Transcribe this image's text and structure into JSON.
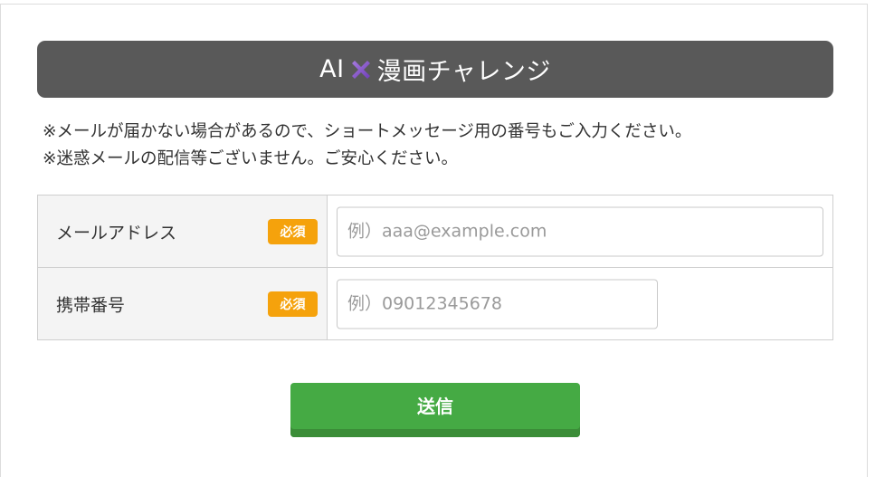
{
  "header": {
    "title_before": "AI",
    "title_after": "漫画チャレンジ",
    "cross_icon_color": "#8a5cc9"
  },
  "notes": [
    "※メールが届かない場合があるので、ショートメッセージ用の番号もご入力ください。",
    "※迷惑メールの配信等ございません。ご安心ください。"
  ],
  "form": {
    "fields": [
      {
        "label": "メールアドレス",
        "badge": "必須",
        "placeholder": "例）aaa@example.com",
        "value": ""
      },
      {
        "label": "携帯番号",
        "badge": "必須",
        "placeholder": "例）09012345678",
        "value": ""
      }
    ],
    "badge_color": "#f5a20c",
    "submit_label": "送信",
    "submit_color": "#45aa44"
  }
}
